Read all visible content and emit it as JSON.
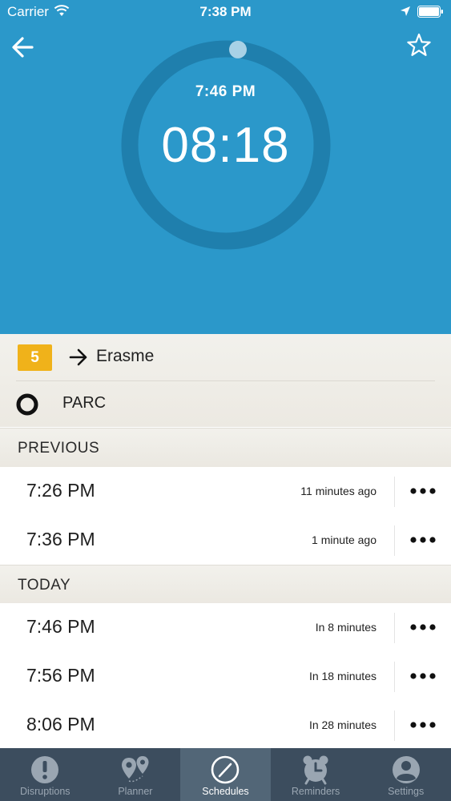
{
  "status_bar": {
    "carrier": "Carrier",
    "time": "7:38 PM"
  },
  "header": {
    "back_icon": "arrow-left-icon",
    "favorite_icon": "star-icon",
    "departure_time": "7:46 PM",
    "countdown": "08:18",
    "progress_fraction": 0.02
  },
  "route": {
    "line_number": "5",
    "line_color": "#f0b21a",
    "destination": "Erasme",
    "stop": "PARC"
  },
  "sections": [
    {
      "title": "PREVIOUS",
      "rows": [
        {
          "time": "7:26 PM",
          "relative": "11 minutes ago"
        },
        {
          "time": "7:36 PM",
          "relative": "1 minute ago"
        }
      ]
    },
    {
      "title": "TODAY",
      "rows": [
        {
          "time": "7:46 PM",
          "relative": "In 8 minutes"
        },
        {
          "time": "7:56 PM",
          "relative": "In 18 minutes"
        },
        {
          "time": "8:06 PM",
          "relative": "In 28 minutes"
        }
      ]
    }
  ],
  "tabs": [
    {
      "label": "Disruptions",
      "icon": "alert-icon",
      "active": false
    },
    {
      "label": "Planner",
      "icon": "map-pin-icon",
      "active": false
    },
    {
      "label": "Schedules",
      "icon": "clock-dial-icon",
      "active": true
    },
    {
      "label": "Reminders",
      "icon": "alarm-clock-icon",
      "active": false
    },
    {
      "label": "Settings",
      "icon": "user-icon",
      "active": false
    }
  ],
  "colors": {
    "header_blue": "#2b98ca",
    "tabbar": "#3c4d5e",
    "tab_active": "#526677"
  }
}
